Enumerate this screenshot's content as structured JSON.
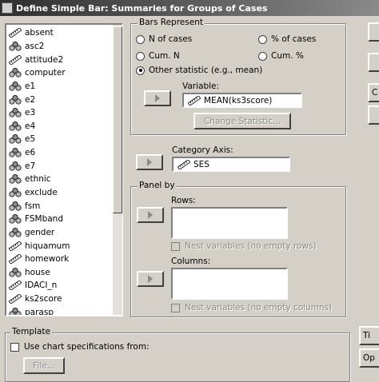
{
  "window": {
    "title": "Define Simple Bar: Summaries for Groups of Cases"
  },
  "variables": [
    {
      "label": "absent",
      "icon": "scale"
    },
    {
      "label": "asc2",
      "icon": "nominal"
    },
    {
      "label": "attitude2",
      "icon": "scale"
    },
    {
      "label": "computer",
      "icon": "nominal"
    },
    {
      "label": "e1",
      "icon": "nominal"
    },
    {
      "label": "e2",
      "icon": "nominal"
    },
    {
      "label": "e3",
      "icon": "nominal"
    },
    {
      "label": "e4",
      "icon": "nominal"
    },
    {
      "label": "e5",
      "icon": "nominal"
    },
    {
      "label": "e6",
      "icon": "nominal"
    },
    {
      "label": "e7",
      "icon": "nominal"
    },
    {
      "label": "ethnic",
      "icon": "nominal"
    },
    {
      "label": "exclude",
      "icon": "nominal"
    },
    {
      "label": "fsm",
      "icon": "nominal"
    },
    {
      "label": "FSMband",
      "icon": "nominal"
    },
    {
      "label": "gender",
      "icon": "nominal"
    },
    {
      "label": "hiquamum",
      "icon": "scale"
    },
    {
      "label": "homework",
      "icon": "scale"
    },
    {
      "label": "house",
      "icon": "nominal"
    },
    {
      "label": "IDACI_n",
      "icon": "scale"
    },
    {
      "label": "ks2score",
      "icon": "scale"
    },
    {
      "label": "parasp",
      "icon": "nominal"
    }
  ],
  "bars_represent": {
    "legend": "Bars Represent",
    "options": {
      "n_of_cases": "N of cases",
      "pct_of_cases": "% of cases",
      "cum_n": "Cum. N",
      "cum_pct": "Cum. %",
      "other": "Other statistic (e.g., mean)"
    },
    "selected": "other",
    "variable_label": "Variable:",
    "variable_value": "MEAN(ks3score)",
    "change_statistic": "Change Statistic..."
  },
  "category_axis": {
    "label": "Category Axis:",
    "value": "SES"
  },
  "panel_by": {
    "legend": "Panel by",
    "rows_label": "Rows:",
    "rows_nest": "Nest variables (no empty rows)",
    "columns_label": "Columns:",
    "columns_nest": "Nest variables (no empty columns)"
  },
  "template": {
    "legend": "Template",
    "use_chart_spec": "Use chart specifications from:",
    "file_button": "File..."
  },
  "right_buttons": {
    "btn3": "C",
    "btn6": "Ti",
    "btn7": "Op"
  }
}
